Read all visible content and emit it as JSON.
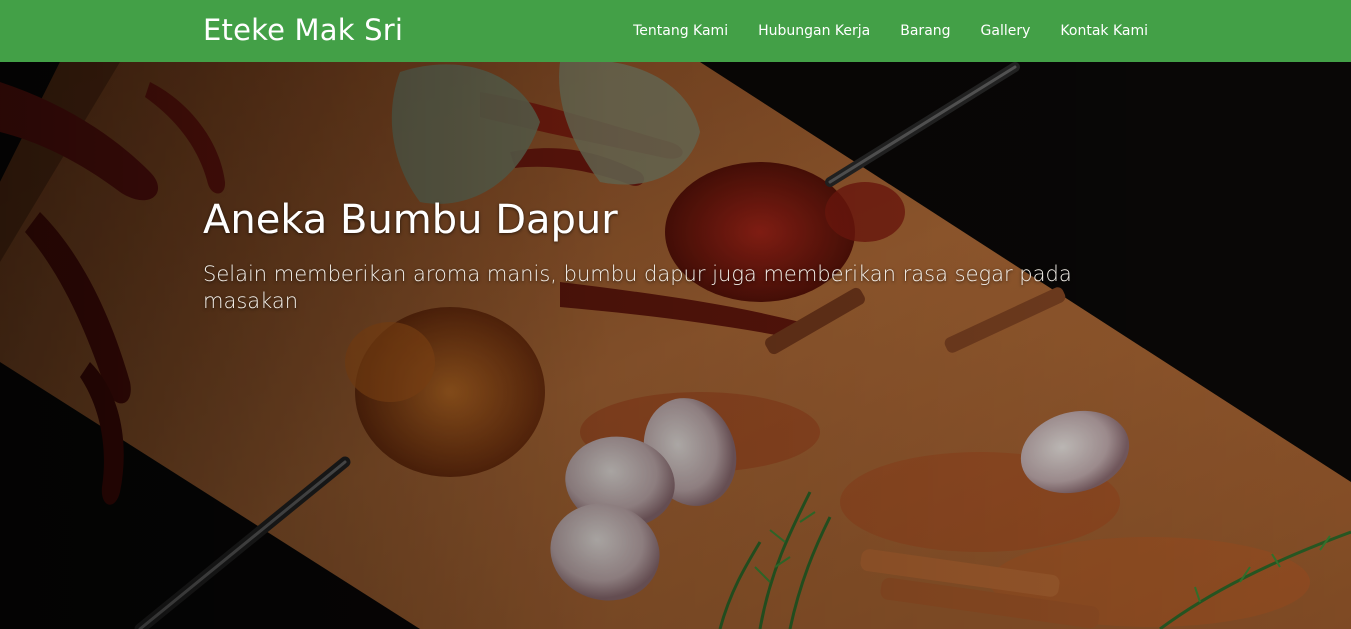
{
  "brand": {
    "name": "Eteke Mak Sri"
  },
  "nav": {
    "items": [
      {
        "label": "Tentang Kami"
      },
      {
        "label": "Hubungan Kerja"
      },
      {
        "label": "Barang"
      },
      {
        "label": "Gallery"
      },
      {
        "label": "Kontak Kami"
      }
    ]
  },
  "hero": {
    "title": "Aneka Bumbu Dapur",
    "subtitle": "Selain memberikan aroma manis, bumbu dapur juga memberikan rasa segar pada masakan",
    "image": "spices-on-cutting-board-photo"
  },
  "colors": {
    "navbar": "#43a047",
    "text": "#ffffff"
  }
}
